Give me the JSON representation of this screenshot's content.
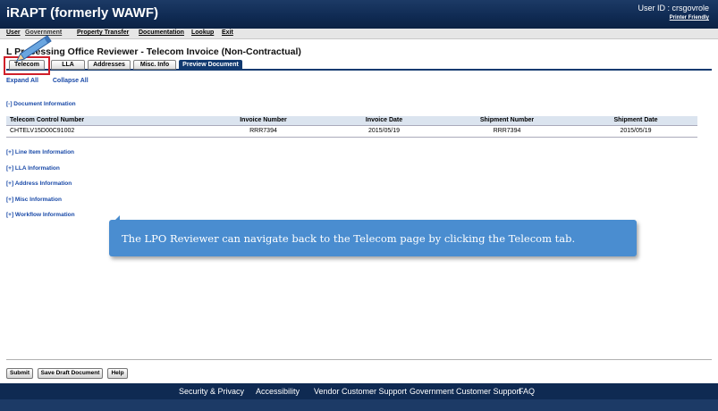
{
  "header": {
    "app_title": "iRAPT (formerly WAWF)",
    "user_id": "User ID : crsgovrole",
    "printer_friendly": "Printer Friendly"
  },
  "menu": {
    "user": "User",
    "government": "Government",
    "property_transfer": "Property Transfer",
    "documentation": "Documentation",
    "lookup": "Lookup",
    "exit": "Exit"
  },
  "page": {
    "title": "Local Processing Office Reviewer - Telecom Invoice (Non-Contractual)",
    "title_visible": "L    Processing Office Reviewer - Telecom Invoice (Non-Contractual)"
  },
  "tabs": [
    {
      "label": "Telecom",
      "active": false
    },
    {
      "label": "LLA",
      "active": false
    },
    {
      "label": "Addresses",
      "active": false
    },
    {
      "label": "Misc. Info",
      "active": false
    },
    {
      "label": "Preview Document",
      "active": true
    }
  ],
  "expand": {
    "expand_all": "Expand All",
    "collapse_all": "Collapse All"
  },
  "document_section": {
    "title": "[-] Document Information",
    "columns": [
      "Telecom Control Number",
      "Invoice Number",
      "Invoice Date",
      "Shipment Number",
      "Shipment Date"
    ],
    "rows": [
      [
        "CHTELV15D00C91002",
        "RRR7394",
        "2015/05/19",
        "RRR7394",
        "2015/05/19"
      ]
    ]
  },
  "sections": [
    "[+] Line Item Information",
    "[+] LLA Information",
    "[+] Address Information",
    "[+] Misc Information",
    "[+] Workflow Information"
  ],
  "callout": {
    "text": "The LPO Reviewer can navigate back to the Telecom page by clicking the Telecom tab."
  },
  "buttons": {
    "submit": "Submit",
    "save_draft": "Save Draft Document",
    "help": "Help"
  },
  "footer": {
    "links": [
      "Security & Privacy",
      "Accessibility",
      "Vendor Customer Support",
      "Government Customer Support",
      "FAQ"
    ]
  },
  "colors": {
    "header_bg": "#0f2a52",
    "active_tab": "#123a70",
    "link": "#1a4aa8",
    "callout": "#4a8dd0",
    "highlight": "#d0202a"
  },
  "icons": {
    "pointer": "pencil-icon"
  }
}
